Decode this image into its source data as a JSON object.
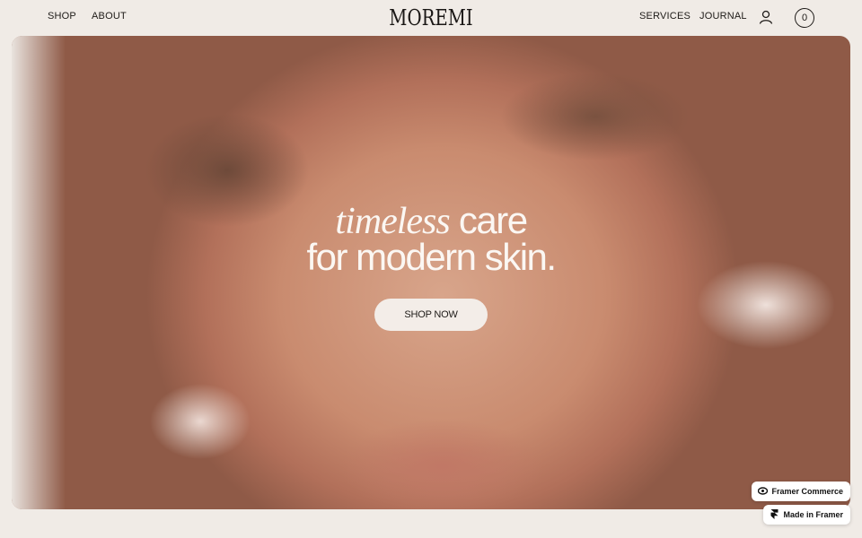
{
  "nav": {
    "left": [
      "SHOP",
      "ABOUT"
    ],
    "right": [
      "SERVICES",
      "JOURNAL"
    ],
    "logo": "MOREMI",
    "account_icon": "user-icon",
    "cart_count": "0"
  },
  "hero": {
    "title_italic": "timeless",
    "title_rest": " care",
    "title_line2": "for modern skin.",
    "cta": "SHOP NOW",
    "image_description_colors": {
      "skin": "#c98b6f",
      "title": "#fbf7f3"
    }
  },
  "badges": {
    "framer_commerce": "Framer Commerce",
    "made_in_framer": "Made in Framer"
  }
}
